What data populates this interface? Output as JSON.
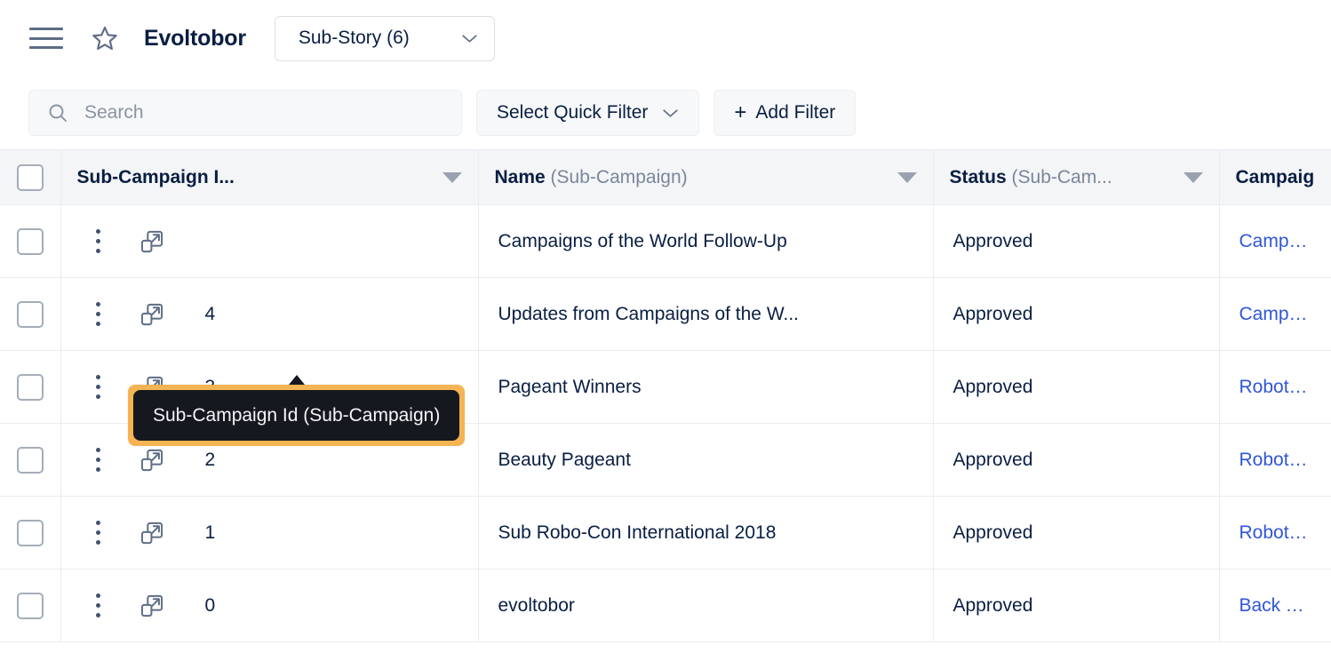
{
  "header": {
    "menu_icon": "hamburger-icon",
    "favorite_icon": "star-icon",
    "title": "Evoltobor",
    "story_selector": {
      "label": "Sub-Story (6)",
      "chevron_icon": "chevron-down-icon"
    }
  },
  "filters": {
    "search": {
      "icon": "search-icon",
      "placeholder": "Search",
      "value": ""
    },
    "quick_filter": {
      "label": "Select Quick Filter",
      "chevron_icon": "chevron-down-icon"
    },
    "add_filter": {
      "label": "Add Filter",
      "plus": "+"
    }
  },
  "table": {
    "select_all_checkbox": "",
    "columns": [
      {
        "label": "Sub-Campaign I...",
        "sub": "",
        "sort_icon": "sort-triangle-icon"
      },
      {
        "label": "Name",
        "sub": "(Sub-Campaign)",
        "sort_icon": "sort-triangle-icon"
      },
      {
        "label": "Status",
        "sub": "(Sub-Cam...",
        "sort_icon": "sort-triangle-icon"
      },
      {
        "label": "Campaig",
        "sub": "",
        "sort_icon": ""
      }
    ],
    "rows": [
      {
        "id": "",
        "name": "Campaigns of the World Follow-Up",
        "status": "Approved",
        "campaign": "Campaig"
      },
      {
        "id": "4",
        "name": "Updates from Campaigns of the W...",
        "status": "Approved",
        "campaign": "Campaig"
      },
      {
        "id": "3",
        "name": "Pageant Winners",
        "status": "Approved",
        "campaign": "Robot Be"
      },
      {
        "id": "2",
        "name": "Beauty Pageant",
        "status": "Approved",
        "campaign": "Robot Be"
      },
      {
        "id": "1",
        "name": "Sub Robo-Con International 2018",
        "status": "Approved",
        "campaign": "Robot-Co"
      },
      {
        "id": "0",
        "name": "evoltobor",
        "status": "Approved",
        "campaign": "Back To S"
      }
    ],
    "row_icons": {
      "kebab": "more-options-icon",
      "popout": "open-in-new-window-icon",
      "checkbox": "row-checkbox"
    }
  },
  "tooltip": {
    "text": "Sub-Campaign Id (Sub-Campaign)",
    "highlight_color": "#F5B453",
    "background_color": "#16181F"
  },
  "colors": {
    "link": "#2F56D9",
    "header_bg": "#F4F5F7",
    "border": "#EBECF0",
    "text": "#091E42",
    "muted": "#7A869A"
  }
}
